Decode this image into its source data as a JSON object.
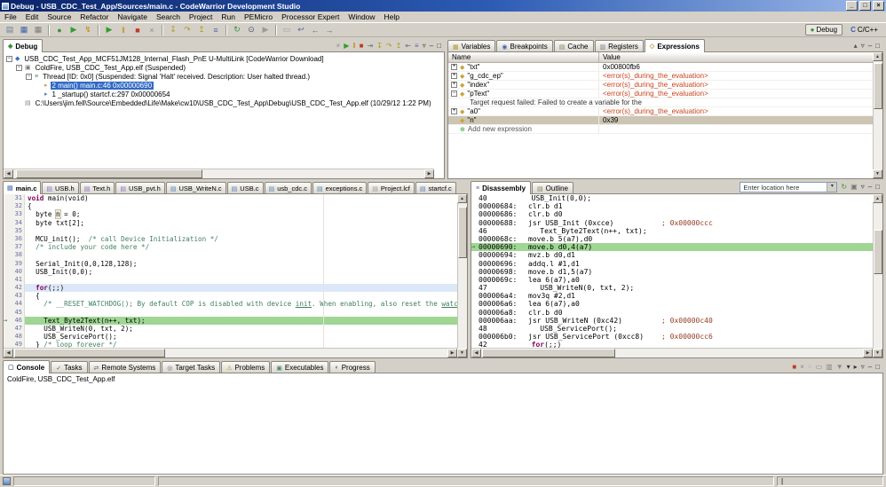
{
  "window": {
    "title": "Debug - USB_CDC_Test_App/Sources/main.c - CodeWarrior Development Studio",
    "min": "_",
    "max": "□",
    "close": "×"
  },
  "menu": [
    "File",
    "Edit",
    "Source",
    "Refactor",
    "Navigate",
    "Search",
    "Project",
    "Run",
    "PEMicro",
    "Processor Expert",
    "Window",
    "Help"
  ],
  "perspectives": {
    "debug": "Debug",
    "cpp": "C/C++"
  },
  "toolbar": {
    "groups": [
      [
        {
          "name": "new",
          "glyph": "▤",
          "color": "#6b7d94"
        },
        {
          "name": "save",
          "glyph": "▦",
          "color": "#3a5fa8"
        },
        {
          "name": "save-all",
          "glyph": "▦",
          "color": "#7a7a7a"
        }
      ],
      [
        {
          "name": "debug",
          "glyph": "●",
          "color": "#3f8f3f"
        },
        {
          "name": "run",
          "glyph": "▶",
          "color": "#2f9e2f"
        },
        {
          "name": "flash-programmer",
          "glyph": "↯",
          "color": "#c08a00"
        }
      ],
      [
        {
          "name": "resume",
          "glyph": "▶",
          "color": "#2f9e2f"
        },
        {
          "name": "suspend",
          "glyph": "‖",
          "color": "#c08a00"
        },
        {
          "name": "terminate",
          "glyph": "■",
          "color": "#c03a2a"
        },
        {
          "name": "disconnect",
          "glyph": "×",
          "color": "#8a8a8a"
        }
      ],
      [
        {
          "name": "step-into",
          "glyph": "↧",
          "color": "#b09a20"
        },
        {
          "name": "step-over",
          "glyph": "↷",
          "color": "#b09a20"
        },
        {
          "name": "step-return",
          "glyph": "↥",
          "color": "#b09a20"
        },
        {
          "name": "instruction-stepping",
          "glyph": "≡",
          "color": "#5566aa"
        }
      ],
      [
        {
          "name": "refresh-debug",
          "glyph": "↻",
          "color": "#3f8f3f"
        },
        {
          "name": "search",
          "glyph": "⊙",
          "color": "#445577"
        },
        {
          "name": "external-tools",
          "glyph": "▶",
          "color": "#9a9a9a"
        }
      ],
      [
        {
          "name": "annotations",
          "glyph": "▭",
          "color": "#999999"
        },
        {
          "name": "last-edit-location",
          "glyph": "↩",
          "color": "#556699"
        },
        {
          "name": "back",
          "glyph": "←",
          "color": "#556699"
        },
        {
          "name": "forward",
          "glyph": "→",
          "color": "#556699"
        }
      ]
    ]
  },
  "debug_view": {
    "tab": "Debug",
    "toolbar": [
      {
        "name": "remove-all-terminated",
        "glyph": "×",
        "color": "#8a8a8a"
      },
      {
        "name": "resume",
        "glyph": "▶",
        "color": "#2f9e2f"
      },
      {
        "name": "suspend",
        "glyph": "‖",
        "color": "#c08a00"
      },
      {
        "name": "terminate",
        "glyph": "■",
        "color": "#c03a2a"
      },
      {
        "name": "disconnect",
        "glyph": "⇥",
        "color": "#777777"
      },
      {
        "name": "step-into",
        "glyph": "↧",
        "color": "#b09a20"
      },
      {
        "name": "step-over",
        "glyph": "↷",
        "color": "#b09a20"
      },
      {
        "name": "step-return",
        "glyph": "↥",
        "color": "#b09a20"
      },
      {
        "name": "drop-to-frame",
        "glyph": "⇤",
        "color": "#777777"
      },
      {
        "name": "instruction-stepping",
        "glyph": "≡",
        "color": "#5566aa"
      },
      {
        "name": "view-menu",
        "glyph": "▿",
        "color": "#333333"
      },
      {
        "name": "minimize",
        "glyph": "–",
        "color": "#333333"
      },
      {
        "name": "maximize",
        "glyph": "□",
        "color": "#333333"
      }
    ],
    "tree": [
      {
        "indent": 0,
        "expander": "-",
        "icon": {
          "name": "launch-config-icon",
          "glyph": "◆",
          "color": "#3a6fbf"
        },
        "text": "USB_CDC_Test_App_MCF51JM128_Internal_Flash_PnE U-MultiLink [CodeWarrior Download]"
      },
      {
        "indent": 1,
        "expander": "-",
        "icon": {
          "name": "process-icon",
          "glyph": "▣",
          "color": "#7a7a7a"
        },
        "text": "ColdFire, USB_CDC_Test_App.elf (Suspended)"
      },
      {
        "indent": 2,
        "expander": "-",
        "icon": {
          "name": "thread-icon",
          "glyph": "≡",
          "color": "#3f8f3f"
        },
        "text": "Thread [ID: 0x0] (Suspended: Signal 'Halt' received. Description: User halted thread.)"
      },
      {
        "indent": 3,
        "expander": "",
        "icon": {
          "name": "stack-frame-icon",
          "glyph": "▸",
          "color": "#c8a43c"
        },
        "text": "2 main() main.c:46 0x00000690",
        "selected": true
      },
      {
        "indent": 3,
        "expander": "",
        "icon": {
          "name": "stack-frame-icon",
          "glyph": "▸",
          "color": "#5577bb"
        },
        "text": "1 _startup() startcf.c:297 0x00000654"
      },
      {
        "indent": 1,
        "expander": "",
        "icon": {
          "name": "elf-file-icon",
          "glyph": "▤",
          "color": "#888888"
        },
        "text": "C:\\Users\\jim.fell\\Source\\Embedded\\Life\\Make\\cw10\\USB_CDC_Test_App\\Debug\\USB_CDC_Test_App.elf (10/29/12 1:22 PM)"
      }
    ]
  },
  "expressions_view": {
    "tabs": [
      {
        "label": "Variables",
        "icon": {
          "name": "variables-icon",
          "glyph": "▦",
          "color": "#b8962e"
        }
      },
      {
        "label": "Breakpoints",
        "icon": {
          "name": "breakpoints-icon",
          "glyph": "◉",
          "color": "#4466aa"
        }
      },
      {
        "label": "Cache",
        "icon": {
          "name": "cache-icon",
          "glyph": "▤",
          "color": "#7a8a5a"
        }
      },
      {
        "label": "Registers",
        "icon": {
          "name": "registers-icon",
          "glyph": "▥",
          "color": "#777788"
        }
      },
      {
        "label": "Expressions",
        "icon": {
          "name": "expressions-icon",
          "glyph": "◇",
          "color": "#b8962e"
        }
      }
    ],
    "active": "Expressions",
    "toolbar": [
      {
        "name": "collapse-all",
        "glyph": "▴",
        "color": "#555555"
      },
      {
        "name": "view-menu",
        "glyph": "▿",
        "color": "#333333"
      },
      {
        "name": "minimize",
        "glyph": "–",
        "color": "#333333"
      },
      {
        "name": "maximize",
        "glyph": "□",
        "color": "#333333"
      }
    ],
    "columns": [
      "Name",
      "Value"
    ],
    "rows": [
      {
        "expander": "+",
        "name": "\"txt\"",
        "value": "0x00800fb6",
        "value_class": "plain"
      },
      {
        "expander": "+",
        "name": "\"g_cdc_ep\"",
        "value": "<error(s)_during_the_evaluation>",
        "value_class": "error"
      },
      {
        "expander": "+",
        "name": "\"index\"",
        "value": "<error(s)_during_the_evaluation>",
        "value_class": "error"
      },
      {
        "expander": "-",
        "name": "\"pText\"",
        "value": "<error(s)_during_the_evaluation>",
        "value_class": "error"
      },
      {
        "child": true,
        "name": "Target request failed: Failed to create a variable for the",
        "value": "",
        "value_class": "plain"
      },
      {
        "expander": "+",
        "name": "\"a0\"",
        "value": "<error(s)_during_the_evaluation>",
        "value_class": "error"
      },
      {
        "expander": "",
        "name": "\"n\"",
        "value": "0x39",
        "value_class": "plain",
        "selected": true
      },
      {
        "add": true,
        "name": "Add new expression",
        "value": "",
        "value_class": "plain"
      }
    ]
  },
  "editor": {
    "tabs": [
      {
        "label": "main.c",
        "type": "c",
        "active": true
      },
      {
        "label": "USB.h",
        "type": "h"
      },
      {
        "label": "Text.h",
        "type": "h"
      },
      {
        "label": "USB_pvt.h",
        "type": "h"
      },
      {
        "label": "USB_WriteN.c",
        "type": "c"
      },
      {
        "label": "USB.c",
        "type": "c"
      },
      {
        "label": "usb_cdc.c",
        "type": "c"
      },
      {
        "label": "exceptions.c",
        "type": "c"
      },
      {
        "label": "Project.lcf",
        "type": "lcf"
      },
      {
        "label": "startcf.c",
        "type": "c"
      }
    ],
    "lines": [
      {
        "num": "31",
        "segs": [
          [
            "k",
            "void"
          ],
          [
            "t",
            " main(void)"
          ]
        ]
      },
      {
        "num": "32",
        "segs": [
          [
            "t",
            "{"
          ]
        ]
      },
      {
        "num": "33",
        "segs": [
          [
            "t",
            "  byte "
          ],
          [
            "o",
            "n"
          ],
          [
            "t",
            " = 0;"
          ]
        ]
      },
      {
        "num": "34",
        "segs": [
          [
            "t",
            "  byte txt[2];"
          ]
        ]
      },
      {
        "num": "35",
        "segs": [
          [
            "t",
            " "
          ]
        ]
      },
      {
        "num": "36",
        "segs": [
          [
            "t",
            "  MCU_init();  "
          ],
          [
            "c",
            "/* call Device Initialization */"
          ]
        ]
      },
      {
        "num": "37",
        "segs": [
          [
            "t",
            "  "
          ],
          [
            "c",
            "/* include your code here */"
          ]
        ]
      },
      {
        "num": "38",
        "segs": [
          [
            "t",
            " "
          ]
        ]
      },
      {
        "num": "39",
        "segs": [
          [
            "t",
            "  Serial_Init(0,0,128,128);"
          ]
        ]
      },
      {
        "num": "40",
        "segs": [
          [
            "t",
            "  USB_Init(0,0);"
          ]
        ]
      },
      {
        "num": "41",
        "segs": [
          [
            "t",
            " "
          ]
        ]
      },
      {
        "num": "42",
        "hl": "cur",
        "segs": [
          [
            "t",
            "  "
          ],
          [
            "k",
            "for"
          ],
          [
            "t",
            "(;;)"
          ]
        ]
      },
      {
        "num": "43",
        "segs": [
          [
            "t",
            "  {"
          ]
        ]
      },
      {
        "num": "44",
        "segs": [
          [
            "t",
            "    "
          ],
          [
            "c",
            "/* __RESET_WATCHDOG(); By default COP is disabled with device "
          ],
          [
            "u",
            "init"
          ],
          [
            "c",
            ". When enabling, also reset the "
          ],
          [
            "u",
            "watchdog"
          ],
          [
            "c",
            ". */"
          ]
        ]
      },
      {
        "num": "45",
        "segs": [
          [
            "t",
            " "
          ]
        ]
      },
      {
        "num": "46",
        "hl": "dbg",
        "segs": [
          [
            "t",
            "    Text_Byte2Text(n++, txt);"
          ]
        ]
      },
      {
        "num": "47",
        "segs": [
          [
            "t",
            "    USB_WriteN(0, txt, 2);"
          ]
        ]
      },
      {
        "num": "48",
        "segs": [
          [
            "t",
            "    USB_ServicePort();"
          ]
        ]
      },
      {
        "num": "49",
        "segs": [
          [
            "t",
            "  } "
          ],
          [
            "c",
            "/* loop forever */"
          ]
        ]
      }
    ]
  },
  "disassembly": {
    "tabs": [
      {
        "label": "Disassembly",
        "active": true,
        "icon": {
          "name": "disassembly-icon",
          "glyph": "≡",
          "color": "#5566aa"
        }
      },
      {
        "label": "Outline",
        "icon": {
          "name": "outline-icon",
          "glyph": "▤",
          "color": "#7a8a5a"
        }
      }
    ],
    "location_placeholder": "Enter location here",
    "toolbar": [
      {
        "name": "refresh",
        "glyph": "↻",
        "color": "#3f8f3f"
      },
      {
        "name": "lock",
        "glyph": "▣",
        "color": "#777777"
      },
      {
        "name": "view-menu",
        "glyph": "▿",
        "color": "#333333"
      },
      {
        "name": "minimize",
        "glyph": "–",
        "color": "#333333"
      },
      {
        "name": "maximize",
        "glyph": "□",
        "color": "#333333"
      }
    ],
    "lines": [
      {
        "type": "src",
        "num": "40",
        "code": [
          [
            "t",
            "  USB_Init(0,0);"
          ]
        ]
      },
      {
        "type": "asm",
        "addr": "00000684:",
        "instr": "clr.b d1"
      },
      {
        "type": "asm",
        "addr": "00000686:",
        "instr": "clr.b d0"
      },
      {
        "type": "asm",
        "addr": "00000688:",
        "instr": "jsr USB_Init (0xcce)",
        "comment": "; 0x00000ccc"
      },
      {
        "type": "src",
        "num": "46",
        "code": [
          [
            "t",
            "    Text_Byte2Text(n++, txt);"
          ]
        ]
      },
      {
        "type": "asm",
        "addr": "0000068c:",
        "instr": "move.b 5(a7),d0"
      },
      {
        "type": "asm",
        "addr": "00000690:",
        "instr": "move.b d0,4(a7)",
        "hl": true
      },
      {
        "type": "asm",
        "addr": "00000694:",
        "instr": "mvz.b d0,d1"
      },
      {
        "type": "asm",
        "addr": "00000696:",
        "instr": "addq.l #1,d1"
      },
      {
        "type": "asm",
        "addr": "00000698:",
        "instr": "move.b d1,5(a7)"
      },
      {
        "type": "asm",
        "addr": "0000069c:",
        "instr": "lea 6(a7),a0"
      },
      {
        "type": "src",
        "num": "47",
        "code": [
          [
            "t",
            "    USB_WriteN(0, txt, 2);"
          ]
        ]
      },
      {
        "type": "asm",
        "addr": "000006a4:",
        "instr": "mov3q #2,d1"
      },
      {
        "type": "asm",
        "addr": "000006a6:",
        "instr": "lea 6(a7),a0"
      },
      {
        "type": "asm",
        "addr": "000006a8:",
        "instr": "clr.b d0"
      },
      {
        "type": "asm",
        "addr": "000006aa:",
        "instr": "jsr USB_WriteN (0xc42)",
        "comment": "; 0x00000c40"
      },
      {
        "type": "src",
        "num": "48",
        "code": [
          [
            "t",
            "    USB_ServicePort();"
          ]
        ]
      },
      {
        "type": "asm",
        "addr": "000006b0:",
        "instr": "jsr USB_ServicePort (0xcc8)",
        "comment": "; 0x00000cc6"
      },
      {
        "type": "src",
        "num": "42",
        "code": [
          [
            "t",
            "  "
          ],
          [
            "k",
            "for"
          ],
          [
            "t",
            "(;;)"
          ]
        ]
      }
    ]
  },
  "console": {
    "tabs": [
      {
        "label": "Console",
        "active": true,
        "icon": {
          "name": "console-icon",
          "glyph": "▢",
          "color": "#556677"
        }
      },
      {
        "label": "Tasks",
        "icon": {
          "name": "tasks-icon",
          "glyph": "✓",
          "color": "#3a7a3a"
        }
      },
      {
        "label": "Remote Systems",
        "icon": {
          "name": "remote-systems-icon",
          "glyph": "⇄",
          "color": "#556699"
        }
      },
      {
        "label": "Target Tasks",
        "icon": {
          "name": "target-tasks-icon",
          "glyph": "◎",
          "color": "#7a5a8a"
        }
      },
      {
        "label": "Problems",
        "icon": {
          "name": "problems-icon",
          "glyph": "⚠",
          "color": "#d09000"
        }
      },
      {
        "label": "Executables",
        "icon": {
          "name": "executables-icon",
          "glyph": "▣",
          "color": "#4a8a5a"
        }
      },
      {
        "label": "Progress",
        "icon": {
          "name": "progress-icon",
          "glyph": "◐",
          "color": "#556699"
        }
      }
    ],
    "toolbar": [
      {
        "name": "terminate-console",
        "glyph": "■",
        "color": "#c03a2a"
      },
      {
        "name": "remove-launch",
        "glyph": "×",
        "color": "#888888"
      },
      {
        "name": "remove-all-launches",
        "glyph": "×",
        "color": "#bbbbbb"
      },
      {
        "name": "clear-console",
        "glyph": "▭",
        "color": "#888888"
      },
      {
        "name": "scroll-lock",
        "glyph": "▥",
        "color": "#888888"
      },
      {
        "name": "pin-console",
        "glyph": "▼",
        "color": "#888888"
      },
      {
        "name": "display-selected-console",
        "glyph": "▾",
        "color": "#333333"
      },
      {
        "name": "open-console",
        "glyph": "▸",
        "color": "#333333"
      },
      {
        "name": "view-menu",
        "glyph": "▿",
        "color": "#333333"
      },
      {
        "name": "minimize",
        "glyph": "–",
        "color": "#333333"
      },
      {
        "name": "maximize",
        "glyph": "□",
        "color": "#333333"
      }
    ],
    "text": "ColdFire, USB_CDC_Test_App.elf"
  },
  "statusbar": {
    "caret": "|"
  }
}
